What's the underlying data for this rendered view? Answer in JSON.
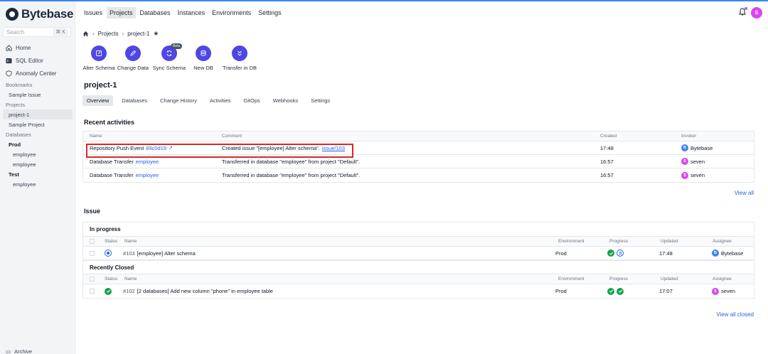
{
  "brand": {
    "name": "Bytebase"
  },
  "sidebar": {
    "search_placeholder": "Search",
    "search_shortcut": "⌘ K",
    "nav": [
      {
        "label": "Home",
        "icon": "home-icon"
      },
      {
        "label": "SQL Editor",
        "icon": "terminal-icon"
      },
      {
        "label": "Anomaly Center",
        "icon": "shield-icon"
      }
    ],
    "bookmarks_label": "Bookmarks",
    "bookmarks": [
      "Sample Issue"
    ],
    "projects_label": "Projects",
    "projects": [
      "project-1",
      "Sample Project"
    ],
    "databases_label": "Databases",
    "db_groups": [
      {
        "name": "Prod",
        "items": [
          "employee",
          "employee"
        ]
      },
      {
        "name": "Test",
        "items": [
          "employee"
        ]
      }
    ],
    "archive_label": "Archive"
  },
  "header": {
    "menu": [
      "Issues",
      "Projects",
      "Databases",
      "Instances",
      "Environments",
      "Settings"
    ],
    "active_menu": "Projects",
    "user_initial": "S"
  },
  "breadcrumb": {
    "items": [
      "Projects",
      "project-1"
    ]
  },
  "actions": [
    {
      "label": "Alter Schema",
      "icon": "edit-icon"
    },
    {
      "label": "Change Data",
      "icon": "pencil-icon"
    },
    {
      "label": "Sync Schema",
      "icon": "refresh-icon",
      "badge": "Beta"
    },
    {
      "label": "New DB",
      "icon": "database-icon"
    },
    {
      "label": "Transfer in DB",
      "icon": "chevrons-down-icon"
    }
  ],
  "project_title": "project-1",
  "tabs": [
    "Overview",
    "Databases",
    "Change History",
    "Activities",
    "GitOps",
    "Webhooks",
    "Settings"
  ],
  "activities": {
    "title": "Recent activities",
    "columns": {
      "name": "Name",
      "comment": "Comment",
      "created": "Created",
      "invoker": "Invoker"
    },
    "rows": [
      {
        "name": "Repository Push Event",
        "name_link": "89c0d19",
        "comment": "Created issue \"[employee] Alter schema\".",
        "comment_link": "issue/103",
        "created": "17:48",
        "invoker": "Bytebase",
        "invoker_initial": "B",
        "invoker_color": "#3b82f6"
      },
      {
        "name": "Database Transfer",
        "name_link": "employee",
        "comment": "Transferred in database \"employee\" from project \"Default\".",
        "comment_link": "",
        "created": "16:57",
        "invoker": "seven",
        "invoker_initial": "S",
        "invoker_color": "#d946ef"
      },
      {
        "name": "Database Transfer",
        "name_link": "employee",
        "comment": "Transferred in database \"employee\" from project \"Default\".",
        "comment_link": "",
        "created": "16:57",
        "invoker": "seven",
        "invoker_initial": "S",
        "invoker_color": "#d946ef"
      }
    ],
    "view_all": "View all"
  },
  "issues": {
    "title": "Issue",
    "columns": {
      "status": "Status",
      "name": "Name",
      "environment": "Environment",
      "progress": "Progress",
      "updated": "Updated",
      "assignee": "Assignee"
    },
    "in_progress": {
      "title": "In progress",
      "rows": [
        {
          "id": "#103",
          "name": "[employee] Alter schema",
          "environment": "Prod",
          "updated": "17:48",
          "assignee": "Bytebase",
          "assignee_initial": "B",
          "assignee_color": "#3b82f6"
        }
      ]
    },
    "closed": {
      "title": "Recently Closed",
      "rows": [
        {
          "id": "#102",
          "name": "[2 databases] Add new column \"phone\" in employee table",
          "environment": "Prod",
          "updated": "17:07",
          "assignee": "seven",
          "assignee_initial": "S",
          "assignee_color": "#d946ef"
        }
      ]
    },
    "view_all_closed": "View all closed"
  }
}
